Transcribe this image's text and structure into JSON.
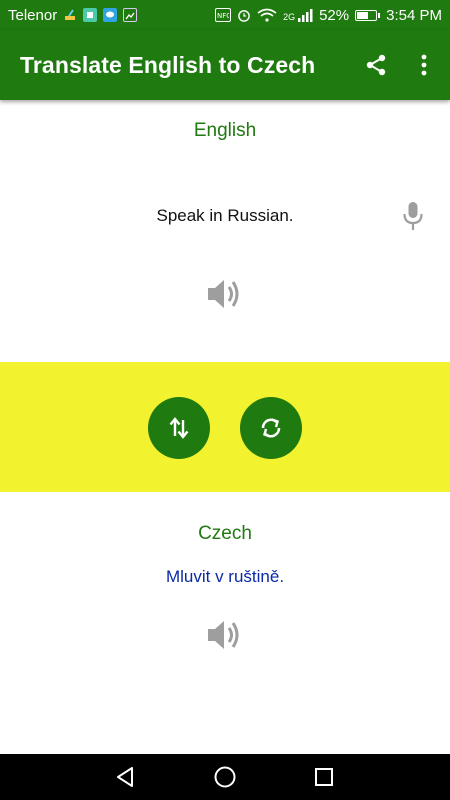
{
  "status_bar": {
    "carrier": "Telenor",
    "network": "2G",
    "battery_percent_text": "52%",
    "battery_level": 0.52,
    "time": "3:54 PM",
    "icons": [
      "sweeper-icon",
      "app-icon",
      "chat-icon",
      "gallery-icon",
      "nfc-icon",
      "alarm-icon",
      "wifi-icon",
      "signal-icon",
      "battery-icon"
    ]
  },
  "app_bar": {
    "title": "Translate English to Czech",
    "share_icon": "share-icon",
    "menu_icon": "more-vert-icon"
  },
  "source": {
    "language": "English",
    "text": "Speak in Russian.",
    "mic_icon": "microphone-icon",
    "speaker_icon": "speaker-icon"
  },
  "actions": {
    "swap_icon": "swap-vertical-icon",
    "refresh_icon": "refresh-icon",
    "band_color": "#f2f22e",
    "button_color": "#1f7a10"
  },
  "target": {
    "language": "Czech",
    "text": "Mluvit v ruštině.",
    "speaker_icon": "speaker-icon"
  },
  "nav_bar": {
    "back_icon": "back-triangle-icon",
    "home_icon": "home-circle-icon",
    "recents_icon": "recents-square-icon"
  },
  "colors": {
    "primary": "#1f7a10",
    "target_text": "#0a2aa6",
    "icon_gray": "#9e9e9e"
  }
}
